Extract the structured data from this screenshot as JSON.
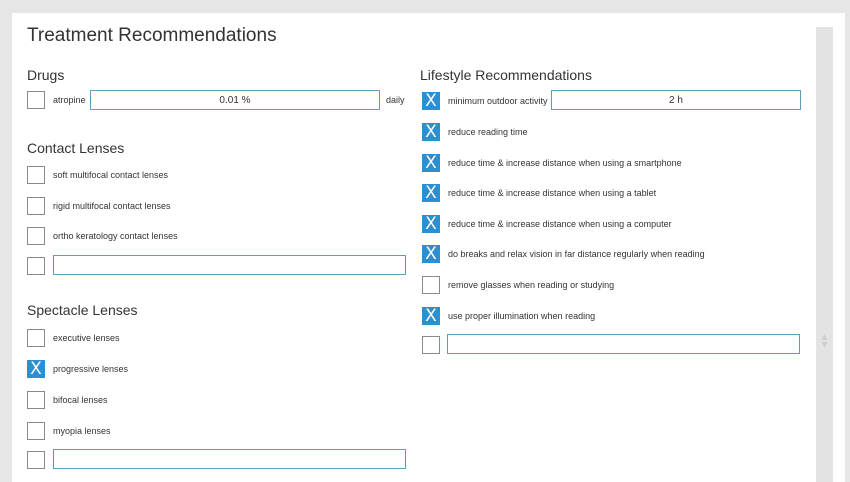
{
  "page_title": "Treatment Recommendations",
  "drugs": {
    "title": "Drugs",
    "items": [
      {
        "label": "atropine",
        "checked": false,
        "value": "0.01 %",
        "unit": "daily"
      }
    ]
  },
  "contact_lenses": {
    "title": "Contact Lenses",
    "items": [
      {
        "label": "soft multifocal contact lenses",
        "checked": false
      },
      {
        "label": "rigid multifocal contact lenses",
        "checked": false
      },
      {
        "label": "ortho keratology contact lenses",
        "checked": false
      }
    ],
    "custom": {
      "checked": false,
      "value": ""
    }
  },
  "spectacle_lenses": {
    "title": "Spectacle Lenses",
    "items": [
      {
        "label": "executive lenses",
        "checked": false
      },
      {
        "label": "progressive lenses",
        "checked": true
      },
      {
        "label": "bifocal lenses",
        "checked": false
      },
      {
        "label": "myopia lenses",
        "checked": false
      }
    ],
    "custom": {
      "checked": false,
      "value": ""
    }
  },
  "lifestyle": {
    "title": "Lifestyle Recommendations",
    "items": [
      {
        "label": "minimum outdoor activity",
        "checked": true,
        "value": "2 h"
      },
      {
        "label": "reduce reading time",
        "checked": true
      },
      {
        "label": "reduce time & increase distance when using a smartphone",
        "checked": true
      },
      {
        "label": "reduce time & increase distance when using a tablet",
        "checked": true
      },
      {
        "label": "reduce time & increase distance when using a computer",
        "checked": true
      },
      {
        "label": "do breaks and relax vision in far distance regularly when reading",
        "checked": true
      },
      {
        "label": "remove glasses when reading or studying",
        "checked": false
      },
      {
        "label": "use proper illumination when reading",
        "checked": true
      }
    ],
    "custom": {
      "checked": false,
      "value": ""
    }
  },
  "icons": {
    "check_mark": "X",
    "scroll": "scroll-arrows-icon"
  }
}
